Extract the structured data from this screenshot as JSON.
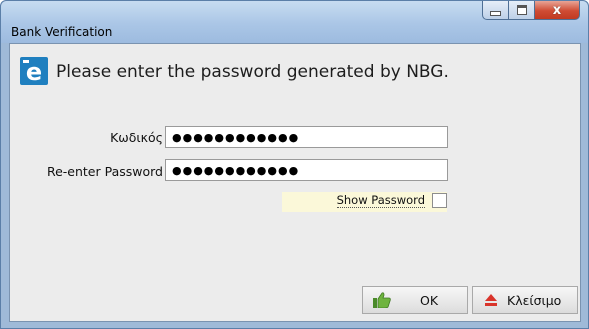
{
  "window": {
    "title": "Bank Verification",
    "close_glyph": "x",
    "accent": "#1f7fbf"
  },
  "header": {
    "icon": "e-logo-icon",
    "icon_letter": "e",
    "text": "Please enter the password generated by NBG."
  },
  "form": {
    "password_label": "Κωδικός",
    "password_value": "●●●●●●●●●●●●",
    "reenter_label": "Re-enter Password",
    "reenter_value": "●●●●●●●●●●●●",
    "show_password_label": "Show Password",
    "show_password_checked": false
  },
  "buttons": {
    "ok_label": "OK",
    "ok_icon": "thumbs-up-icon",
    "close_label": "Κλείσιμο",
    "close_icon": "eject-icon"
  }
}
